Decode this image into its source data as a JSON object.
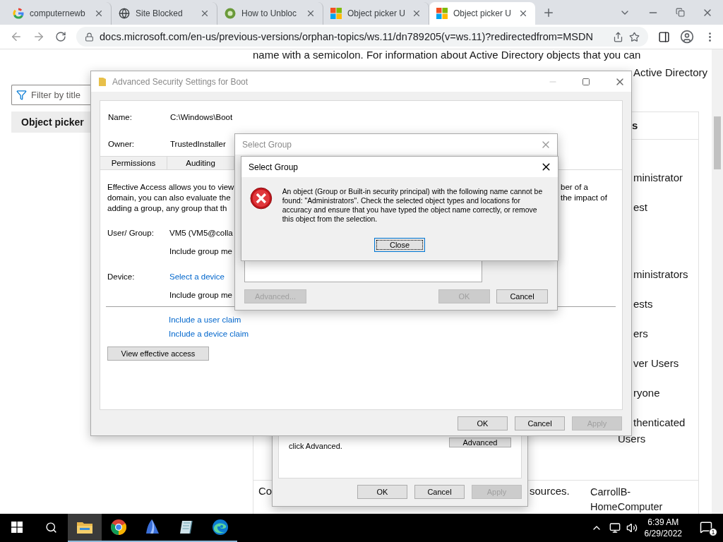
{
  "browser": {
    "tabs": [
      {
        "title": "computernewb",
        "kind": "google",
        "selected": false
      },
      {
        "title": "Site Blocked",
        "kind": "globe",
        "selected": false
      },
      {
        "title": "How to Unbloc",
        "kind": "badge",
        "selected": false
      },
      {
        "title": "Object picker U",
        "kind": "microsoft",
        "selected": false
      },
      {
        "title": "Object picker U",
        "kind": "microsoft",
        "selected": true
      }
    ],
    "url": "docs.microsoft.com/en-us/previous-versions/orphan-topics/ws.11/dn789205(v=ws.11)?redirectedfrom=MSDN"
  },
  "page": {
    "top_line": "name with a semicolon. For information about Active Directory objects that you can",
    "line_2_end": "Active Directory",
    "filter": {
      "placeholder": "Filter by title"
    },
    "toc_item": {
      "label": "Object picker",
      "selected": true
    },
    "table": {
      "header": "s",
      "cells": [
        "ministrator",
        "est",
        "ministrators",
        "ests",
        "ers",
        "ver Users",
        "ryone",
        "thenticated"
      ],
      "cell_last_line": "Users",
      "bottom_row": {
        "cell_1": "Co",
        "cell_2": "sources.",
        "cell_3": "CarrollB-HomeComputer"
      }
    }
  },
  "properties_window": {
    "note_lines": [
      "click Advanced."
    ],
    "advanced_button": "Advanced",
    "buttons": [
      {
        "label": "OK",
        "disabled": false
      },
      {
        "label": "Cancel",
        "disabled": false
      },
      {
        "label": "Apply",
        "disabled": true
      }
    ]
  },
  "advanced_window": {
    "title": "Advanced Security Settings for Boot",
    "name_label": "Name:",
    "name_value": "C:\\Windows\\Boot",
    "owner_label": "Owner:",
    "owner_value": "TrustedInstaller",
    "tabs": [
      {
        "label": "Permissions",
        "selected": false
      },
      {
        "label": "Auditing",
        "selected": false
      }
    ],
    "description_lines": [
      "Effective Access allows you to view",
      "domain, you can also evaluate the",
      "adding a group, any group that th"
    ],
    "description_tail": [
      "ber of a",
      "the impact of"
    ],
    "user_group_label": "User/ Group:",
    "user_group_value": "VM5 (VM5@colla",
    "include_1": "Include group me",
    "device_label": "Device:",
    "device_link": "Select a device",
    "include_2": "Include group me",
    "claim_links": [
      "Include a user claim",
      "Include a device claim"
    ],
    "view_button": "View effective access",
    "buttons": [
      {
        "label": "OK",
        "disabled": false
      },
      {
        "label": "Cancel",
        "disabled": false
      },
      {
        "label": "Apply",
        "disabled": true
      }
    ]
  },
  "select_group_window": {
    "title": "Select Group",
    "buttons": [
      {
        "label": "Advanced...",
        "disabled": true
      },
      {
        "label": "OK",
        "disabled": true
      },
      {
        "label": "Cancel",
        "disabled": false
      }
    ]
  },
  "error_dialog": {
    "title": "Select Group",
    "message": "An object (Group or Built-in security principal) with the following name cannot be found: \"Administrators\". Check the selected object types and locations for accuracy and ensure that you have typed the object name correctly, or remove this object from the selection.",
    "close_button": "Close"
  },
  "taskbar": {
    "apps": [
      {
        "kind": "explorer",
        "selected": true
      },
      {
        "kind": "chrome",
        "selected": false
      },
      {
        "kind": "sail",
        "selected": false
      },
      {
        "kind": "notepad",
        "selected": false
      },
      {
        "kind": "edge",
        "selected": false
      }
    ],
    "time": "6:39 AM",
    "date": "6/29/2022",
    "notification_count": "1"
  }
}
